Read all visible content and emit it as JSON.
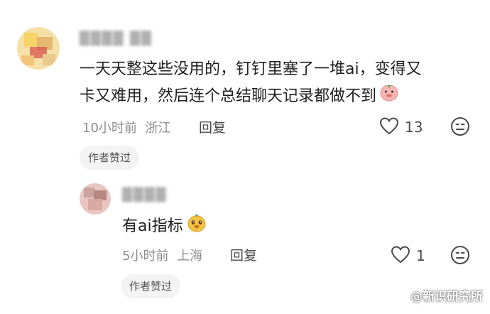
{
  "comment": {
    "username": "████ ██",
    "text_line1": "一天天整这些没用的，钉钉里塞了一堆ai，变得又",
    "text_line2": "卡又难用，然后连个总结聊天记录都做不到",
    "emoji_icon": "pig-face-icon",
    "time": "10小时前",
    "location": "浙江",
    "reply_label": "回复",
    "like_count": "13",
    "author_liked_label": "作者赞过"
  },
  "reply": {
    "username": "████",
    "text": "有ai指标",
    "emoji_icon": "dog-face-icon",
    "time": "5小时前",
    "location": "上海",
    "reply_label": "回复",
    "like_count": "1",
    "author_liked_label": "作者赞过"
  },
  "watermark": "@新识研究所",
  "colors": {
    "text": "#1f1f1f",
    "meta": "#8c8c8c",
    "badge_bg": "#f3f3f3"
  }
}
